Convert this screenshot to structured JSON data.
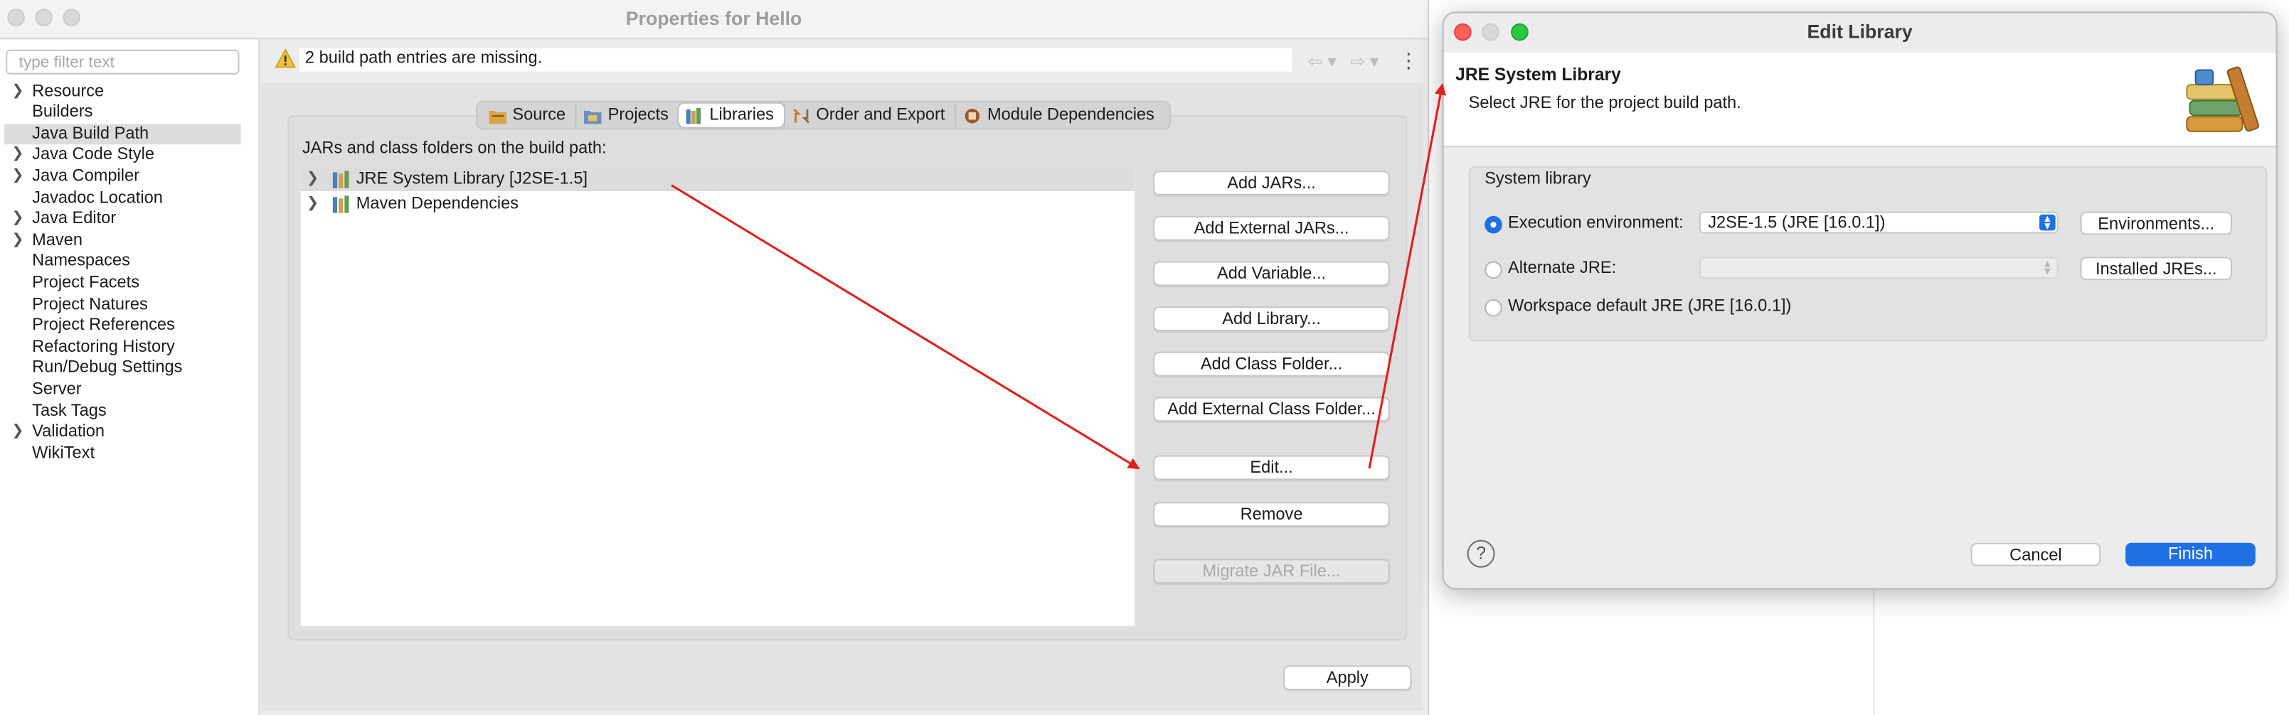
{
  "properties_window": {
    "title": "Properties for Hello",
    "filter_placeholder": "type filter text",
    "nav_items": [
      {
        "label": "Resource",
        "expandable": true
      },
      {
        "label": "Builders",
        "expandable": false
      },
      {
        "label": "Java Build Path",
        "expandable": false,
        "selected": true
      },
      {
        "label": "Java Code Style",
        "expandable": true
      },
      {
        "label": "Java Compiler",
        "expandable": true
      },
      {
        "label": "Javadoc Location",
        "expandable": false
      },
      {
        "label": "Java Editor",
        "expandable": true
      },
      {
        "label": "Maven",
        "expandable": true
      },
      {
        "label": "Namespaces",
        "expandable": false
      },
      {
        "label": "Project Facets",
        "expandable": false
      },
      {
        "label": "Project Natures",
        "expandable": false
      },
      {
        "label": "Project References",
        "expandable": false
      },
      {
        "label": "Refactoring History",
        "expandable": false
      },
      {
        "label": "Run/Debug Settings",
        "expandable": false
      },
      {
        "label": "Server",
        "expandable": false
      },
      {
        "label": "Task Tags",
        "expandable": false
      },
      {
        "label": "Validation",
        "expandable": true
      },
      {
        "label": "WikiText",
        "expandable": false
      }
    ],
    "warning": "2 build path entries are missing.",
    "tabs": [
      {
        "label": "Source",
        "icon": "source-folder-icon"
      },
      {
        "label": "Projects",
        "icon": "projects-icon"
      },
      {
        "label": "Libraries",
        "icon": "libraries-icon",
        "active": true
      },
      {
        "label": "Order and Export",
        "icon": "order-export-icon"
      },
      {
        "label": "Module Dependencies",
        "icon": "module-dependencies-icon"
      }
    ],
    "section_label": "JARs and class folders on the build path:",
    "tree_items": [
      {
        "label": "JRE System Library [J2SE-1.5]",
        "selected": true
      },
      {
        "label": "Maven Dependencies",
        "selected": false
      }
    ],
    "buttons": {
      "add_jars": "Add JARs...",
      "add_external_jars": "Add External JARs...",
      "add_variable": "Add Variable...",
      "add_library": "Add Library...",
      "add_class_folder": "Add Class Folder...",
      "add_external_class_folder": "Add External Class Folder...",
      "edit": "Edit...",
      "remove": "Remove",
      "migrate_jar": "Migrate JAR File...",
      "apply": "Apply"
    },
    "nav_back_icon": "⇦ ▾",
    "nav_forward_icon": "⇨ ▾",
    "menu_icon": "⋮"
  },
  "edit_library_dialog": {
    "title": "Edit Library",
    "heading": "JRE System Library",
    "description": "Select JRE for the project build path.",
    "group_label": "System library",
    "execution_env_label": "Execution environment:",
    "execution_env_value": "J2SE-1.5 (JRE [16.0.1])",
    "alternate_jre_label": "Alternate JRE:",
    "alternate_jre_value": "",
    "workspace_default_label": "Workspace default JRE (JRE [16.0.1])",
    "selected_option": "execution_environment",
    "environments_button": "Environments...",
    "installed_jres_button": "Installed JREs...",
    "help_glyph": "?",
    "cancel_button": "Cancel",
    "finish_button": "Finish"
  },
  "colors": {
    "accent_blue": "#1f6fe5",
    "annotation_red": "#e0201c",
    "close_light": "#ff5f57",
    "minimize_light": "#febc2e",
    "zoom_light": "#28c840"
  }
}
